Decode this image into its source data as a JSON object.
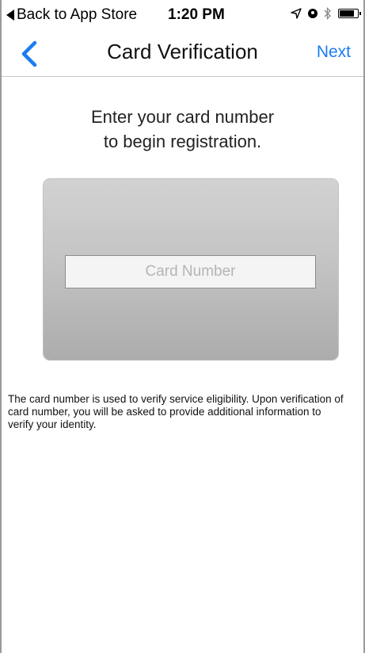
{
  "status_bar": {
    "back_label": "Back to App Store",
    "time": "1:20 PM",
    "icons": [
      "location-icon",
      "alarm-icon",
      "bluetooth-icon",
      "battery-icon"
    ]
  },
  "nav": {
    "title": "Card Verification",
    "next_label": "Next",
    "back_icon": "chevron-left-icon",
    "accent_color": "#1a7cf2"
  },
  "content": {
    "prompt_line1": "Enter your card number",
    "prompt_line2": "to begin registration.",
    "card_input": {
      "placeholder": "Card Number",
      "value": ""
    },
    "info_text": "The card number is used to verify service eligibility. Upon verification of card number, you will be asked to provide additional information to verify your identity."
  }
}
